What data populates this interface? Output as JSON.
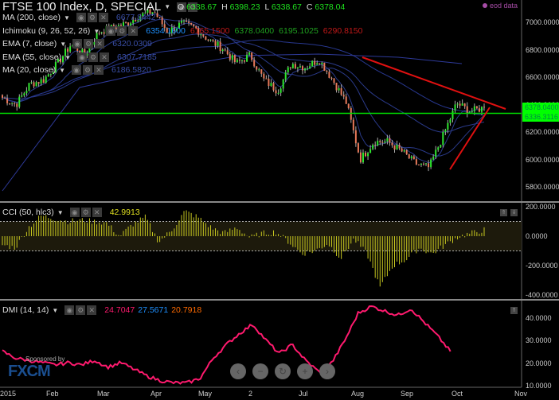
{
  "header": {
    "title": "FTSE 100 Index, D, SPECIAL",
    "ohlc": [
      {
        "k": "O",
        "v": "6338.67"
      },
      {
        "k": "H",
        "v": "6398.23"
      },
      {
        "k": "L",
        "v": "6338.67"
      },
      {
        "k": "C",
        "v": "6378.04"
      }
    ],
    "eod": "eod data"
  },
  "indicators": [
    {
      "label": "MA (200, close)",
      "value": "6677.8442",
      "color": "#3a4fa8"
    },
    {
      "label": "Ichimoku (9, 26, 52, 26)",
      "values": [
        {
          "v": "6354.1600",
          "c": "#1e90ff"
        },
        {
          "v": "6165.1500",
          "c": "#c01818"
        },
        {
          "v": "6378.0400",
          "c": "#1fa01f"
        },
        {
          "v": "6195.1025",
          "c": "#1fa01f"
        },
        {
          "v": "6290.8150",
          "c": "#c01818"
        }
      ]
    },
    {
      "label": "EMA (7, close)",
      "value": "6320.0309",
      "color": "#3a4fa8"
    },
    {
      "label": "EMA (55, close)",
      "value": "6307.7185",
      "color": "#3a4fa8"
    },
    {
      "label": "MA (20, close)",
      "value": "6186.5820",
      "color": "#3a4fa8"
    }
  ],
  "cci": {
    "label": "CCI (50, hlc3)",
    "value": "42.9913",
    "color": "#e0e020"
  },
  "dmi": {
    "label": "DMI (14, 14)",
    "values": [
      {
        "v": "24.7047",
        "c": "#ff1a6e"
      },
      {
        "v": "27.5671",
        "c": "#1e90ff"
      },
      {
        "v": "20.7918",
        "c": "#ff6a00"
      }
    ]
  },
  "price_axis": [
    "7000.0000",
    "6800.0000",
    "6600.0000",
    "6400.0000",
    "6200.0000",
    "6000.0000",
    "5800.0000"
  ],
  "price_tags": [
    "6378.0400",
    "6336.3116"
  ],
  "cci_axis": [
    "200.0000",
    "0.0000",
    "-200.0000",
    "-400.0000"
  ],
  "dmi_axis": [
    "40.0000",
    "30.0000",
    "20.0000",
    "10.0000"
  ],
  "x_axis": [
    "2015",
    "Feb",
    "Mar",
    "Apr",
    "May",
    "2",
    "Jul",
    "Aug",
    "Sep",
    "Oct",
    "Nov"
  ],
  "nav": {
    "prev": "‹",
    "zoom_out": "−",
    "reset": "↻",
    "zoom_in": "+",
    "next": "›"
  },
  "logo": {
    "sponsored": "Sponsored by",
    "brand": "FXCM"
  },
  "chart_data": {
    "type": "candlestick",
    "close_path": [
      6450,
      6400,
      6550,
      6580,
      6700,
      6840,
      6760,
      6930,
      6960,
      6990,
      7050,
      7080,
      6930,
      6990,
      6960,
      6870,
      6810,
      6700,
      6760,
      6580,
      6500,
      6700,
      6670,
      6730,
      6580,
      6410,
      6000,
      6130,
      6130,
      6060,
      5970,
      5940,
      6170,
      6410,
      6350,
      6378
    ],
    "support_level": 6336.3116,
    "cci_path": [
      -60,
      -80,
      60,
      140,
      120,
      100,
      110,
      100,
      90,
      0,
      80,
      130,
      -40,
      40,
      170,
      130,
      60,
      20,
      60,
      -10,
      20,
      30,
      -40,
      -120,
      -100,
      -50,
      -150,
      -20,
      -120,
      -350,
      -200,
      -160,
      -80,
      -120,
      -60,
      -5,
      20,
      43
    ],
    "dmi_path": [
      25,
      22,
      21,
      20,
      19,
      20,
      19,
      21,
      18,
      20,
      17,
      14,
      12,
      11,
      11,
      13,
      22,
      28,
      33,
      37,
      30,
      24,
      28,
      21,
      16,
      20,
      30,
      42,
      45,
      43,
      41,
      44,
      38,
      32,
      25
    ]
  }
}
